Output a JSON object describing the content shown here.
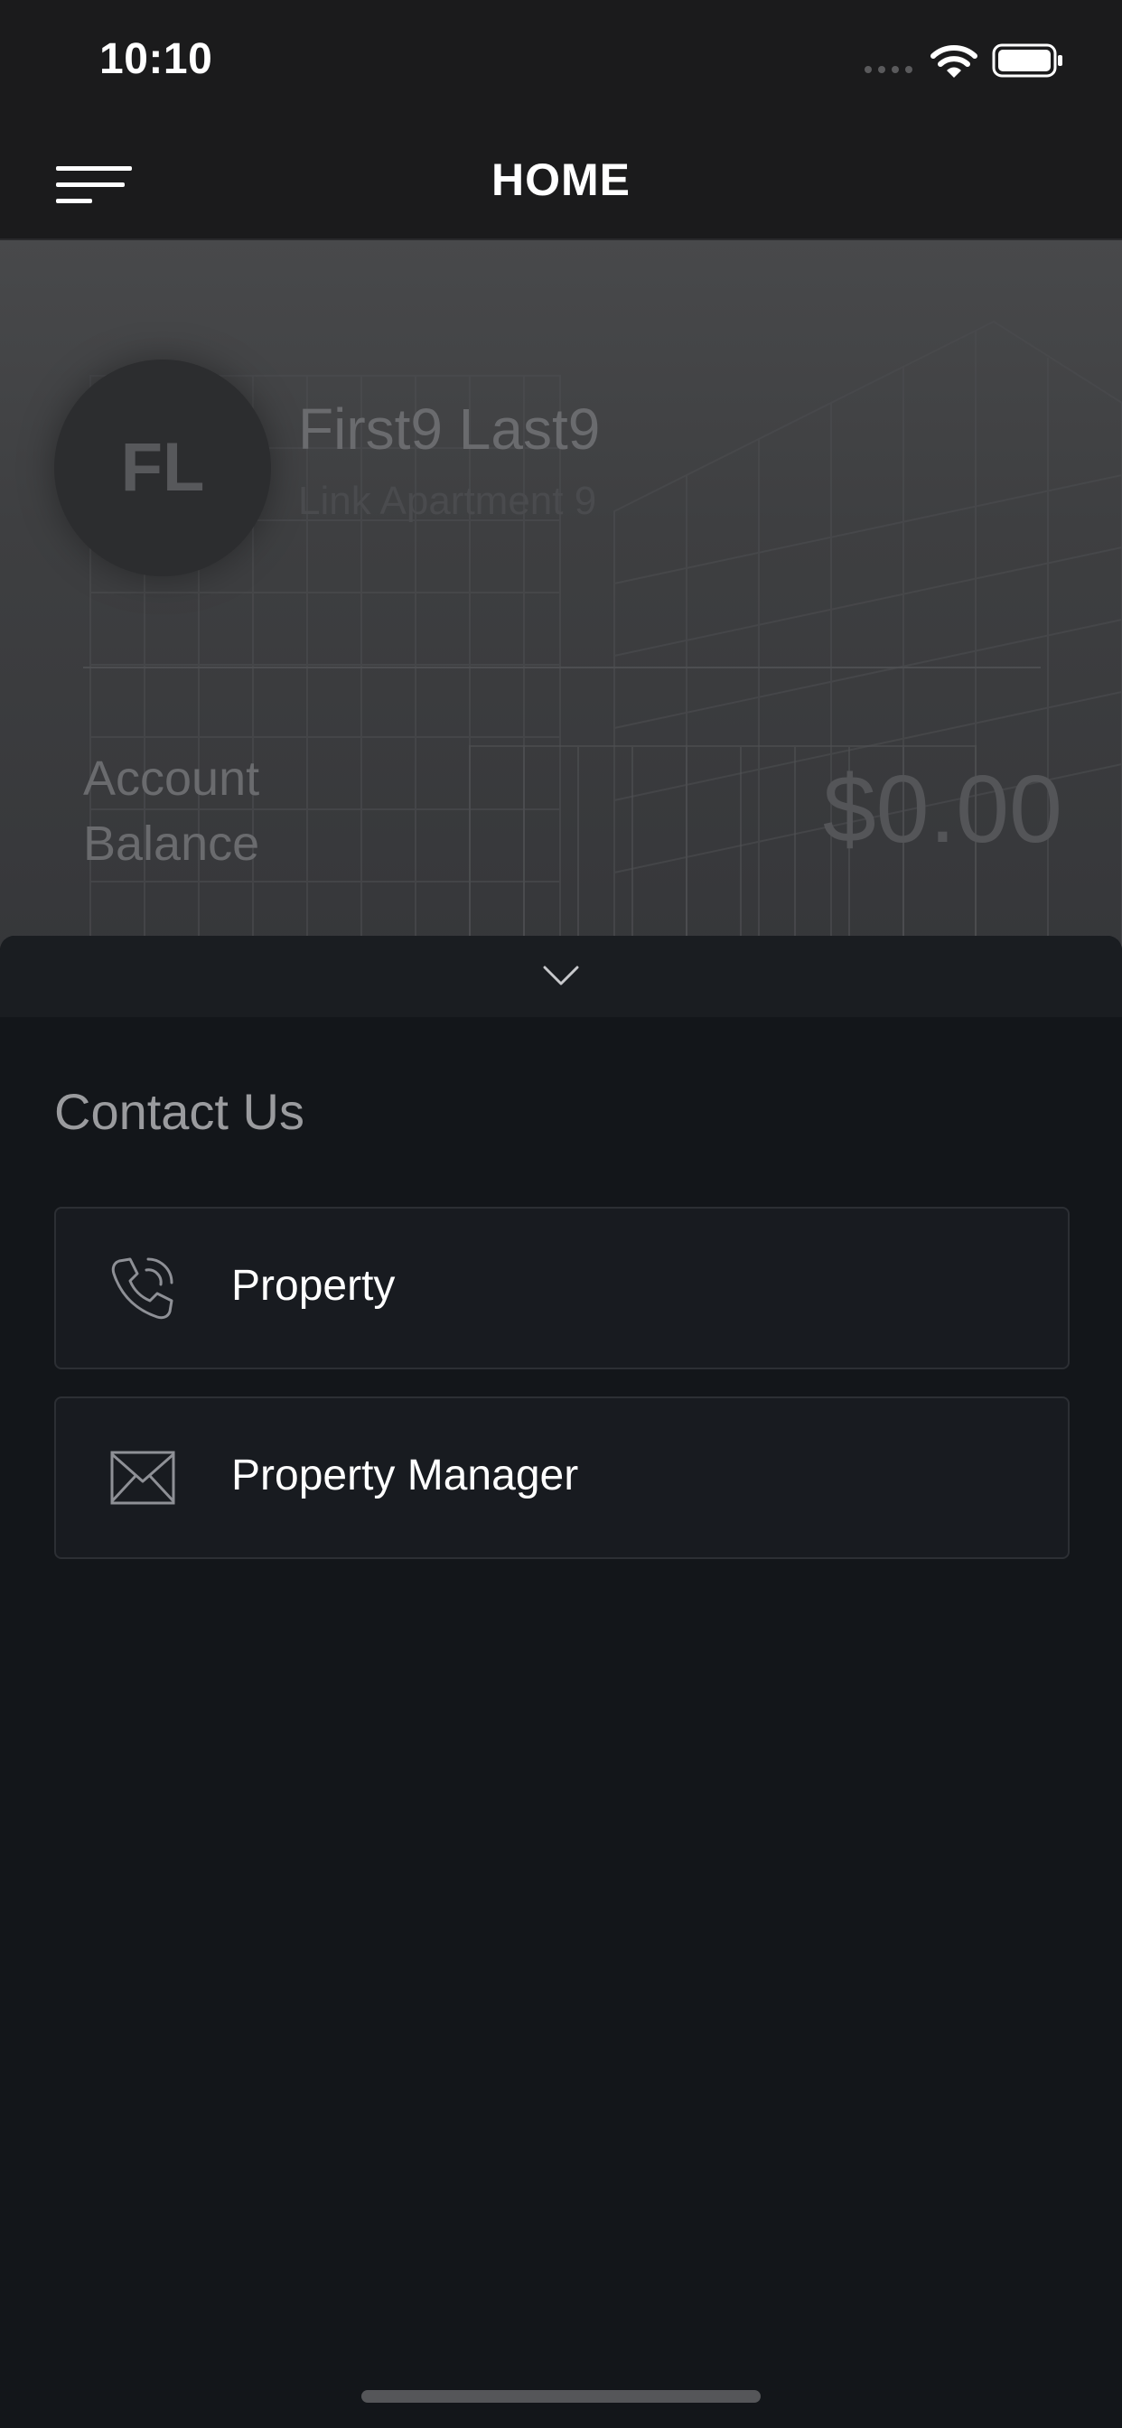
{
  "status_bar": {
    "time": "10:10",
    "signal_icon": "signal-dots-icon",
    "wifi_icon": "wifi-icon",
    "battery_icon": "battery-icon"
  },
  "nav": {
    "title": "HOME",
    "menu_icon": "menu-icon"
  },
  "hero": {
    "avatar_initials": "FL",
    "user_name": "First9 Last9",
    "user_unit": "Link Apartment 9",
    "balance_label": "Account Balance",
    "balance_value": "$0.00"
  },
  "sheet": {
    "toggle_icon": "chevron-down-icon",
    "section_title": "Contact Us",
    "contacts": [
      {
        "label": "Property",
        "icon": "phone-icon"
      },
      {
        "label": "Property Manager",
        "icon": "mail-icon"
      }
    ]
  },
  "colors": {
    "bar_background": "#1b1b1c",
    "sheet_background": "#13161a",
    "card_background": "#181b20",
    "card_border": "#2c2f34",
    "text_primary": "#ffffff",
    "text_muted": "#9a9b9e"
  }
}
